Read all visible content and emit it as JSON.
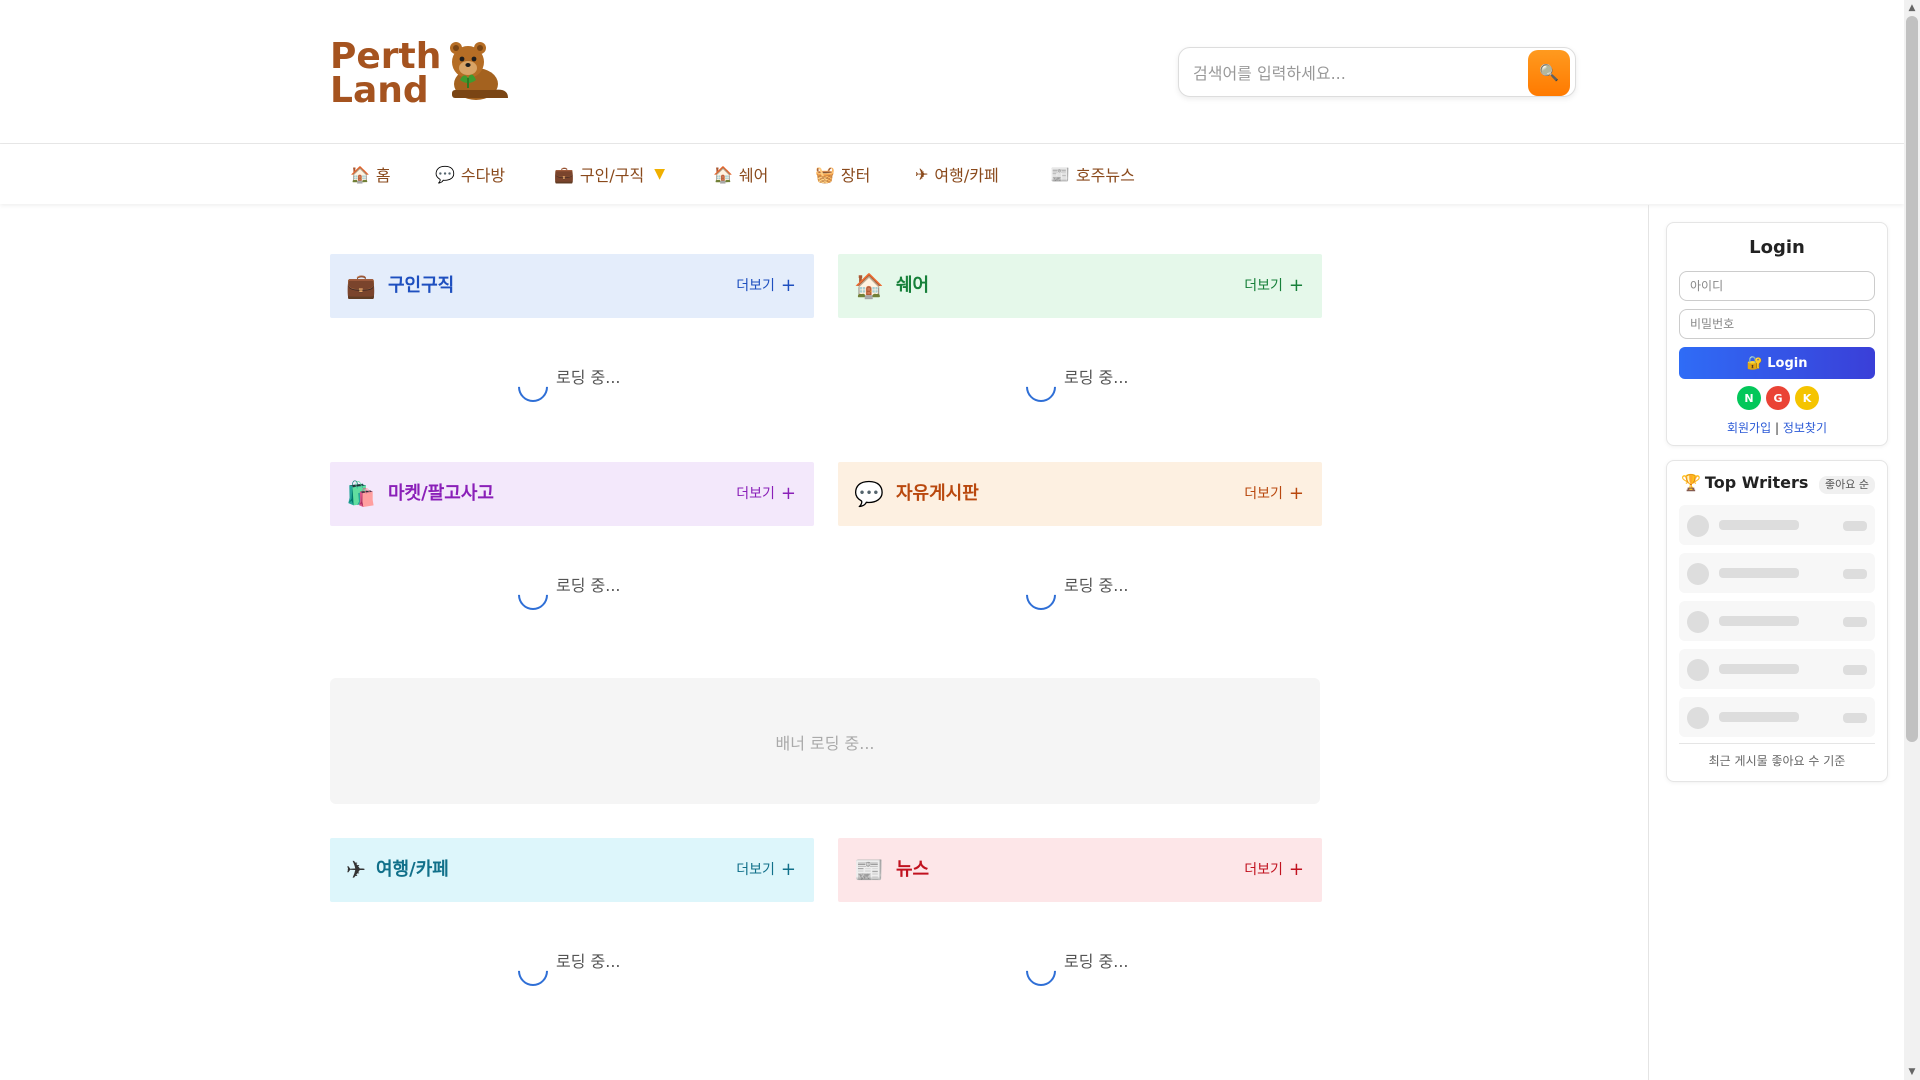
{
  "logo": {
    "line1": "Perth",
    "line2": "Land",
    "icon": "quokka-icon"
  },
  "search": {
    "placeholder": "검색어를 입력하세요...",
    "button_icon": "🔍"
  },
  "nav": {
    "items": [
      {
        "icon": "🏠",
        "label": "홈"
      },
      {
        "icon": "💬",
        "label": "수다방"
      },
      {
        "icon": "💼",
        "label": "구인/구직",
        "caret": "▼"
      },
      {
        "icon": "🏠",
        "label": "쉐어"
      },
      {
        "icon": "🧺",
        "label": "장터"
      },
      {
        "icon": "✈",
        "label": "여행/카페"
      },
      {
        "icon": "📰",
        "label": "호주뉴스"
      }
    ]
  },
  "sections": [
    {
      "icon": "💼",
      "title": "구인구직",
      "more": "더보기",
      "plus": "+",
      "loading": "로딩 중...",
      "bg": "#e4edfb",
      "color": "#1e4fbf"
    },
    {
      "icon": "🏠",
      "title": "쉐어",
      "more": "더보기",
      "plus": "+",
      "loading": "로딩 중...",
      "bg": "#e5f8ea",
      "color": "#17803a"
    },
    {
      "icon": "🛍️",
      "title": "마켓/팔고사고",
      "more": "더보기",
      "plus": "+",
      "loading": "로딩 중...",
      "bg": "#f3e8fb",
      "color": "#8a1fb8"
    },
    {
      "icon": "💬",
      "title": "자유게시판",
      "more": "더보기",
      "plus": "+",
      "loading": "로딩 중...",
      "bg": "#fdf0e1",
      "color": "#b9480e"
    },
    {
      "icon": "✈",
      "title": "여행/카페",
      "more": "더보기",
      "plus": "+",
      "loading": "로딩 중...",
      "bg": "#ddf6fb",
      "color": "#11708a"
    },
    {
      "icon": "📰",
      "title": "뉴스",
      "more": "더보기",
      "plus": "+",
      "loading": "로딩 중...",
      "bg": "#fde6e8",
      "color": "#c1121f"
    }
  ],
  "banner": {
    "text": "배너 로딩 중..."
  },
  "login": {
    "title": "Login",
    "id_placeholder": "아이디",
    "pw_placeholder": "비밀번호",
    "button": "🔐 Login",
    "social": [
      {
        "label": "N",
        "color": "#03c75a"
      },
      {
        "label": "G",
        "color": "#ea4335"
      },
      {
        "label": "K",
        "color": "#f5c400"
      }
    ],
    "signup": "회원가입",
    "separator": "|",
    "find": "정보찾기"
  },
  "writers": {
    "icon": "🏆",
    "title": "Top Writers",
    "sort": "좋아요 순",
    "footer": "최근 게시물 좋아요 수 기준"
  }
}
